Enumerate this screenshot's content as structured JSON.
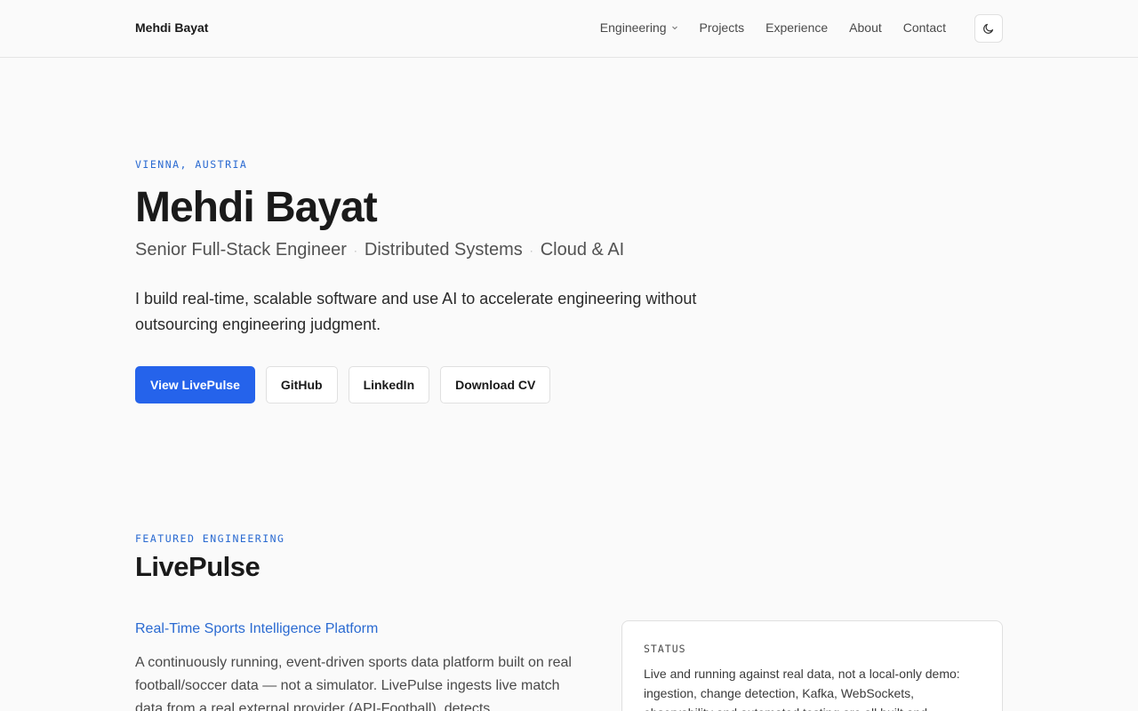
{
  "nav": {
    "brand": "Mehdi Bayat",
    "links": [
      {
        "label": "Engineering",
        "has_dropdown": true
      },
      {
        "label": "Projects"
      },
      {
        "label": "Experience"
      },
      {
        "label": "About"
      },
      {
        "label": "Contact"
      }
    ],
    "theme_toggle_icon": "moon-icon"
  },
  "hero": {
    "location": "VIENNA, AUSTRIA",
    "name": "Mehdi Bayat",
    "roles": [
      "Senior Full-Stack Engineer",
      "Distributed Systems",
      "Cloud & AI"
    ],
    "lede": "I build real-time, scalable software and use AI to accelerate engineering without outsourcing engineering judgment.",
    "buttons": {
      "primary": "View LivePulse",
      "github": "GitHub",
      "linkedin": "LinkedIn",
      "cv": "Download CV"
    }
  },
  "featured": {
    "eyebrow": "FEATURED ENGINEERING",
    "title": "LivePulse",
    "subtitle": "Real-Time Sports Intelligence Platform",
    "description": "A continuously running, event-driven sports data platform built on real football/soccer data — not a simulator. LivePulse ingests live match data from a real external provider (API-Football), detects",
    "status_label": "STATUS",
    "status_text": "Live and running against real data, not a local-only demo: ingestion, change detection, Kafka, WebSockets, observability and automated testing are all built and"
  },
  "colors": {
    "accent": "#2563eb",
    "eyebrow": "#2a6ad1",
    "background": "#fafafa"
  }
}
